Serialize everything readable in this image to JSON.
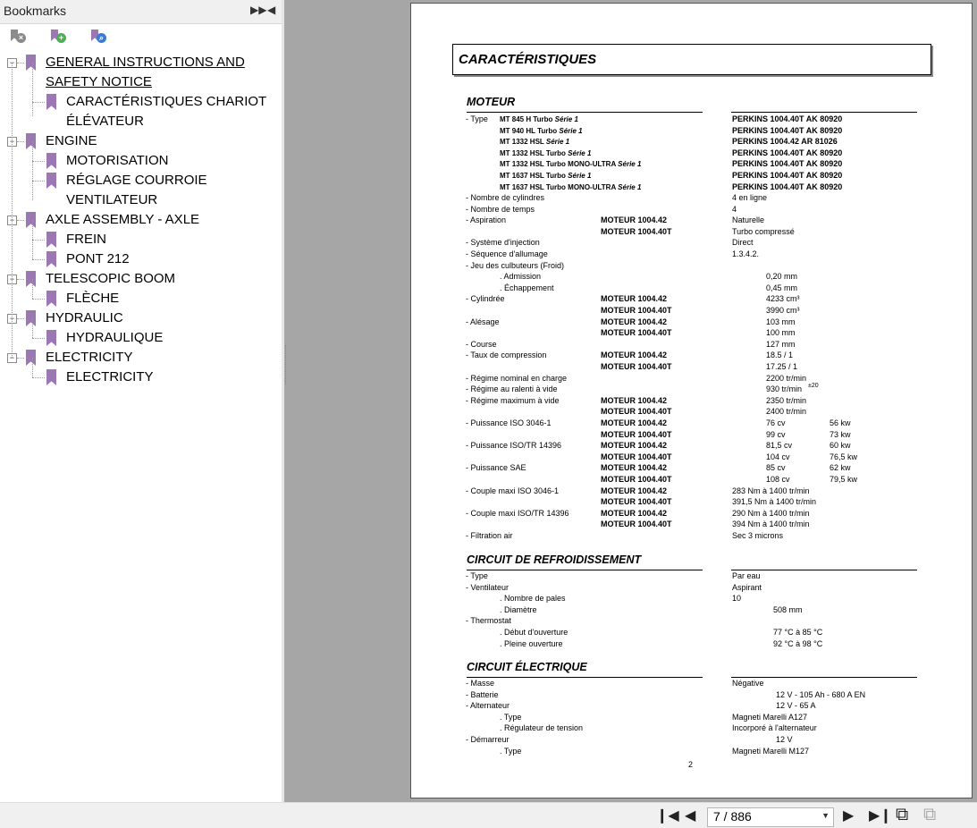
{
  "bookmarks": {
    "title": "Bookmarks",
    "items": [
      {
        "label": "GENERAL INSTRUCTIONS AND"
      },
      {
        "label": "SAFETY NOTICE"
      },
      {
        "label": "CARACTÉRISTIQUES CHARIOT"
      },
      {
        "label": "ÉLÉVATEUR"
      },
      {
        "label": "ENGINE"
      },
      {
        "label": "MOTORISATION"
      },
      {
        "label": "RÉGLAGE COURROIE"
      },
      {
        "label": "VENTILATEUR"
      },
      {
        "label": "AXLE ASSEMBLY - AXLE"
      },
      {
        "label": "FREIN"
      },
      {
        "label": "PONT 212"
      },
      {
        "label": "TELESCOPIC BOOM"
      },
      {
        "label": "FLÈCHE"
      },
      {
        "label": "HYDRAULIC"
      },
      {
        "label": "HYDRAULIQUE"
      },
      {
        "label": "ELECTRICITY"
      },
      {
        "label": "ELECTRICITY"
      }
    ]
  },
  "document": {
    "title": "CARACTÉRISTIQUES",
    "page_number": "2",
    "moteur": {
      "heading": "MOTEUR",
      "type_label": "- Type",
      "models": [
        {
          "name": "MT 845 H Turbo",
          "serie": "Série 1",
          "engine": "PERKINS 1004.40T AK 80920"
        },
        {
          "name": "MT 940 HL Turbo",
          "serie": "Série 1",
          "engine": "PERKINS 1004.40T AK 80920"
        },
        {
          "name": "MT 1332 HSL",
          "serie": "Série 1",
          "engine": "PERKINS 1004.42 AR 81026"
        },
        {
          "name": "MT 1332 HSL Turbo",
          "serie": "Série 1",
          "engine": "PERKINS 1004.40T AK 80920"
        },
        {
          "name": "MT 1332 HSL Turbo MONO-ULTRA",
          "serie": "Série 1",
          "engine": "PERKINS 1004.40T AK 80920"
        },
        {
          "name": "MT 1637 HSL Turbo",
          "serie": "Série 1",
          "engine": "PERKINS 1004.40T AK 80920"
        },
        {
          "name": "MT 1637 HSL Turbo MONO-ULTRA",
          "serie": "Série 1",
          "engine": "PERKINS 1004.40T AK 80920"
        }
      ],
      "rows": [
        {
          "label": "- Nombre de cylindres",
          "mid": "",
          "val": "4 en ligne",
          "val2": ""
        },
        {
          "label": "- Nombre de temps",
          "mid": "",
          "val": "4",
          "val2": ""
        },
        {
          "label": "- Aspiration",
          "mid": "MOTEUR 1004.42",
          "val": "Naturelle",
          "val2": ""
        },
        {
          "label": "",
          "mid": "MOTEUR 1004.40T",
          "val": "Turbo compressé",
          "val2": ""
        },
        {
          "label": "- Système d'injection",
          "mid": "",
          "val": "Direct",
          "val2": ""
        },
        {
          "label": "- Séquence d'allumage",
          "mid": "",
          "val": "1.3.4.2.",
          "val2": ""
        },
        {
          "label": "- Jeu des culbuteurs (Froid)",
          "mid": "",
          "val": "",
          "val2": ""
        },
        {
          "label": ". Admission",
          "mid": "",
          "val": "",
          "val2": "0,20 mm",
          "indent": true
        },
        {
          "label": ". Échappement",
          "mid": "",
          "val": "",
          "val2": "0,45 mm",
          "indent": true
        },
        {
          "label": "- Cylindrée",
          "mid": "MOTEUR 1004.42",
          "val": "",
          "val2": "4233 cm³"
        },
        {
          "label": "",
          "mid": "MOTEUR 1004.40T",
          "val": "",
          "val2": "3990 cm³"
        },
        {
          "label": "- Alésage",
          "mid": "MOTEUR 1004.42",
          "val": "",
          "val2": "103 mm"
        },
        {
          "label": "",
          "mid": "MOTEUR 1004.40T",
          "val": "",
          "val2": "100 mm"
        },
        {
          "label": "- Course",
          "mid": "",
          "val": "",
          "val2": "127 mm"
        },
        {
          "label": "- Taux de compression",
          "mid": "MOTEUR 1004.42",
          "val": "",
          "val2": "18.5 / 1"
        },
        {
          "label": "",
          "mid": "MOTEUR 1004.40T",
          "val": "",
          "val2": "17.25 / 1"
        },
        {
          "label": "- Régime nominal en charge",
          "mid": "",
          "val": "",
          "val2": "2200 tr/min"
        },
        {
          "label": "- Régime au ralenti à vide",
          "mid": "",
          "val": "",
          "val2": "930 tr/min"
        },
        {
          "label": "- Régime maximum à vide",
          "mid": "MOTEUR 1004.42",
          "val": "",
          "val2": "2350 tr/min"
        },
        {
          "label": "",
          "mid": "MOTEUR 1004.40T",
          "val": "",
          "val2": "2400 tr/min"
        },
        {
          "label": "- Puissance ISO 3046-1",
          "mid": "MOTEUR 1004.42",
          "val": "",
          "val2": "76 cv",
          "kw": "56 kw"
        },
        {
          "label": "",
          "mid": "MOTEUR 1004.40T",
          "val": "",
          "val2": "99 cv",
          "kw": "73 kw"
        },
        {
          "label": "- Puissance ISO/TR 14396",
          "mid": "MOTEUR 1004.42",
          "val": "",
          "val2": "81,5 cv",
          "kw": "60 kw"
        },
        {
          "label": "",
          "mid": "MOTEUR 1004.40T",
          "val": "",
          "val2": "104 cv",
          "kw": "76,5 kw"
        },
        {
          "label": "- Puissance SAE",
          "mid": "MOTEUR 1004.42",
          "val": "",
          "val2": "85 cv",
          "kw": "62 kw"
        },
        {
          "label": "",
          "mid": "MOTEUR 1004.40T",
          "val": "",
          "val2": "108 cv",
          "kw": "79,5 kw"
        },
        {
          "label": "- Couple maxi ISO 3046-1",
          "mid": "MOTEUR 1004.42",
          "val": "283 Nm à 1400 tr/min",
          "val2": ""
        },
        {
          "label": "",
          "mid": "MOTEUR 1004.40T",
          "val": "391,5 Nm à 1400 tr/min",
          "val2": ""
        },
        {
          "label": "- Couple maxi ISO/TR 14396",
          "mid": "MOTEUR 1004.42",
          "val": "290 Nm à 1400 tr/min",
          "val2": ""
        },
        {
          "label": "",
          "mid": "MOTEUR 1004.40T",
          "val": "394 Nm à 1400 tr/min",
          "val2": ""
        },
        {
          "label": "- Filtration air",
          "mid": "",
          "val": "Sec 3 microns",
          "val2": ""
        }
      ],
      "ralenti_tolerance": "±20"
    },
    "refroidissement": {
      "heading": "CIRCUIT DE REFROIDISSEMENT",
      "rows": [
        {
          "label": "- Type",
          "val": "Par eau",
          "val2": ""
        },
        {
          "label": "- Ventilateur",
          "val": "Aspirant",
          "val2": ""
        },
        {
          "label": ". Nombre de pales",
          "val": "10",
          "val2": "",
          "indent": true
        },
        {
          "label": ". Diamètre",
          "val": "",
          "val2": "508 mm",
          "indent": true
        },
        {
          "label": "- Thermostat",
          "val": "",
          "val2": ""
        },
        {
          "label": ". Début d'ouverture",
          "val": "",
          "val2": "77 °C à 85 °C",
          "indent": true
        },
        {
          "label": ". Pleine ouverture",
          "val": "",
          "val2": "92 °C à 98 °C",
          "indent": true
        }
      ]
    },
    "electrique": {
      "heading": "CIRCUIT ÉLECTRIQUE",
      "rows": [
        {
          "label": "- Masse",
          "val": "Négative",
          "val2": ""
        },
        {
          "label": "- Batterie",
          "val": "",
          "val2": "12 V - 105 Ah - 680 A EN"
        },
        {
          "label": "- Alternateur",
          "val": "",
          "val2": "12 V - 65 A"
        },
        {
          "label": ". Type",
          "val": "Magneti Marelli A127",
          "val2": "",
          "indent": true
        },
        {
          "label": ". Régulateur de tension",
          "val": "Incorporé à l'alternateur",
          "val2": "",
          "indent": true
        },
        {
          "label": "- Démarreur",
          "val": "",
          "val2": "12 V"
        },
        {
          "label": ". Type",
          "val": "Magneti Marelli M127",
          "val2": "",
          "indent": true
        }
      ]
    }
  },
  "navigation": {
    "current_page": "7 / 886"
  }
}
